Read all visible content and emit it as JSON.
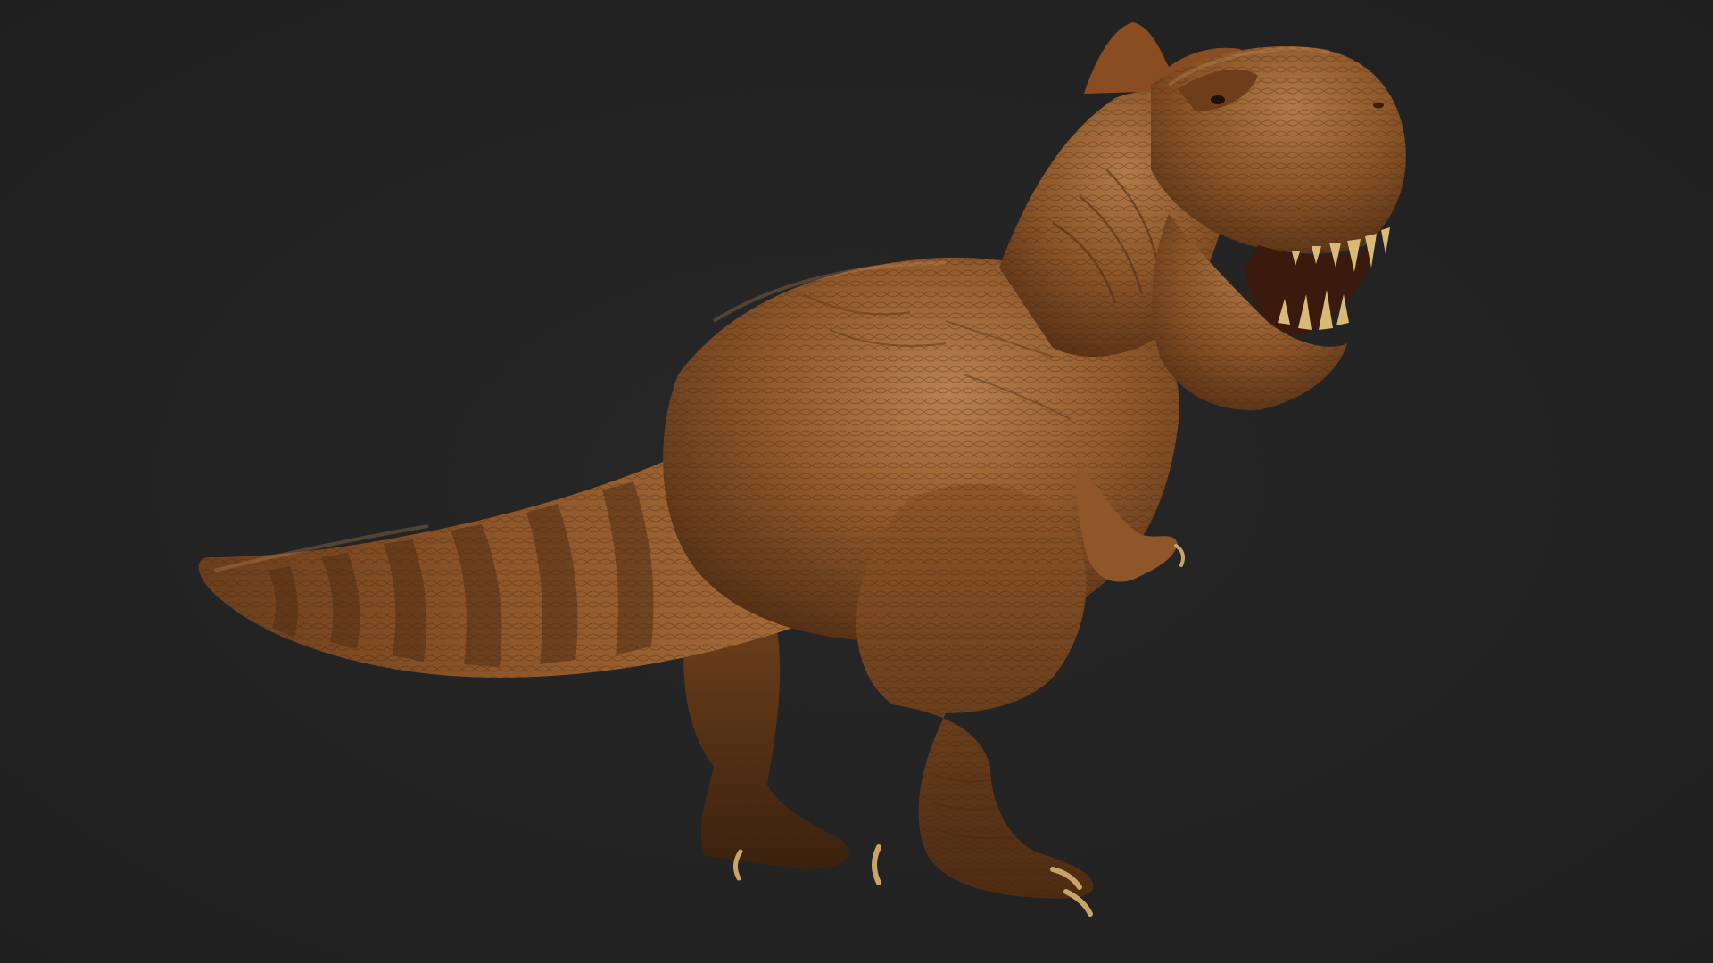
{
  "scene": {
    "subject": "t-rex-render",
    "colors": {
      "background": "#232323",
      "skin_light": "#b27a4a",
      "skin_mid": "#8a5428",
      "skin_dark": "#4a2a12",
      "stripe": "#5a3418",
      "teeth": "#d9b978",
      "claw": "#c8a468"
    }
  }
}
